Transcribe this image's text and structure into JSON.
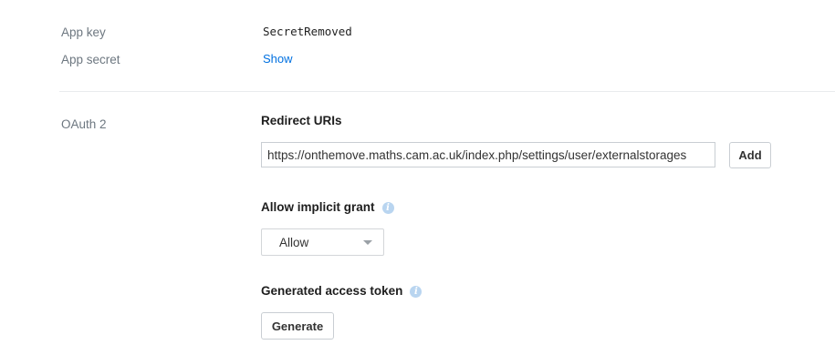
{
  "credentials": {
    "app_key_label": "App key",
    "app_key_value": "SecretRemoved",
    "app_secret_label": "App secret",
    "app_secret_action": "Show"
  },
  "oauth": {
    "section_label": "OAuth 2",
    "redirect": {
      "heading": "Redirect URIs",
      "input_value": "https://onthemove.maths.cam.ac.uk/index.php/settings/user/externalstorages",
      "add_button": "Add"
    },
    "implicit_grant": {
      "heading": "Allow implicit grant",
      "info_icon": "info-icon",
      "selected": "Allow"
    },
    "access_token": {
      "heading": "Generated access token",
      "info_icon": "info-icon",
      "button": "Generate"
    }
  },
  "colors": {
    "link": "#0070e0",
    "label": "#6d7780",
    "info_icon": "#b9d5f0"
  }
}
